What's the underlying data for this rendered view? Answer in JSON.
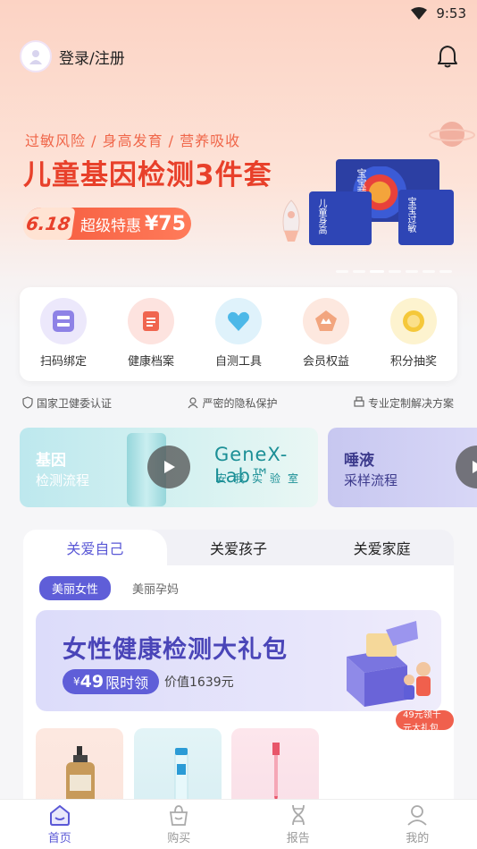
{
  "status_bar": {
    "time": "9:53"
  },
  "header": {
    "login_label": "登录/注册"
  },
  "banner": {
    "subtitle": "过敏风险 / 身高发育 / 营养吸收",
    "title": "儿童基因检测3件套",
    "promo_tag": "6.18",
    "promo_label": "超级特惠",
    "price": "¥75",
    "box_labels": [
      "宝宝营养",
      "儿童身高",
      "宝宝过敏"
    ]
  },
  "tools": [
    {
      "label": "扫码绑定",
      "icon": "scan-icon"
    },
    {
      "label": "健康档案",
      "icon": "health-record-icon"
    },
    {
      "label": "自测工具",
      "icon": "heart-icon"
    },
    {
      "label": "会员权益",
      "icon": "crown-icon"
    },
    {
      "label": "积分抽奖",
      "icon": "coin-icon"
    }
  ],
  "trust": [
    "国家卫健委认证",
    "严密的隐私保护",
    "专业定制解决方案"
  ],
  "videos": [
    {
      "title": "基因",
      "subtitle": "检测流程",
      "lab_name": "GeneX-Lab™",
      "lab_sub": "安我实验室"
    },
    {
      "title": "唾液",
      "subtitle": "采样流程"
    }
  ],
  "care": {
    "tabs": [
      "关爱自己",
      "关爱孩子",
      "关爱家庭"
    ],
    "chips": [
      "美丽女性",
      "美丽孕妈"
    ],
    "promo_title": "女性健康检测大礼包",
    "promo_price_symbol": "¥",
    "promo_price": "49",
    "promo_price_label": "限时领",
    "promo_value": "价值1639元",
    "promo_badge": "49元领千元大礼包"
  },
  "bottom_nav": [
    {
      "label": "首页",
      "icon": "home-icon",
      "active": true
    },
    {
      "label": "购买",
      "icon": "bag-icon",
      "active": false
    },
    {
      "label": "报告",
      "icon": "dna-icon",
      "active": false
    },
    {
      "label": "我的",
      "icon": "profile-icon",
      "active": false
    }
  ],
  "colors": {
    "accent": "#5a58d6",
    "banner_red": "#e8402a"
  }
}
